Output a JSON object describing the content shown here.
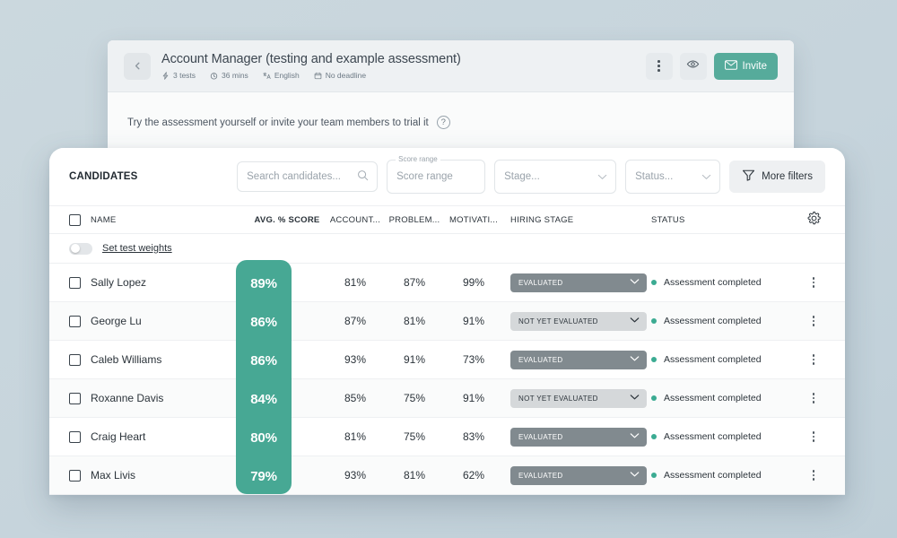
{
  "assessment": {
    "back_icon": "chevron-left-icon",
    "title": "Account Manager (testing and example assessment)",
    "meta": [
      {
        "icon": "lightning-icon",
        "label": "3 tests"
      },
      {
        "icon": "clock-icon",
        "label": "36 mins"
      },
      {
        "icon": "language-icon",
        "label": "English"
      },
      {
        "icon": "calendar-icon",
        "label": "No deadline"
      }
    ],
    "actions": {
      "kebab_icon": "more-vertical-icon",
      "preview_icon": "eye-icon",
      "invite_label": "Invite",
      "invite_icon": "envelope-icon",
      "invite_color": "#56ab9b"
    },
    "trial_banner": {
      "text": "Try the assessment yourself or invite your team members to trial it",
      "help_icon": "question-mark-icon",
      "help_glyph": "?"
    }
  },
  "candidates": {
    "panel_label": "CANDIDATES",
    "search": {
      "placeholder": "Search candidates...",
      "value": "",
      "icon": "search-icon"
    },
    "filters": [
      {
        "name": "score-range",
        "legend": "Score range",
        "value": "Score range",
        "has_caret": false
      },
      {
        "name": "stage",
        "legend": "",
        "value": "Stage...",
        "has_caret": true
      },
      {
        "name": "status",
        "legend": "",
        "value": "Status...",
        "has_caret": true
      }
    ],
    "more_filters": {
      "label": "More filters",
      "icon": "filter-icon"
    },
    "settings_icon": "gear-icon",
    "columns": [
      "NAME",
      "AVG. % SCORE",
      "ACCOUNT...",
      "PROBLEM...",
      "MOTIVATI...",
      "HIRING STAGE",
      "STATUS"
    ],
    "weights_row": {
      "label": "Set test weights",
      "toggle_on": false
    },
    "highlight_color": "#47a894",
    "status_dot_color": "#3bab92",
    "rows": [
      {
        "name": "Sally Lopez",
        "avg": "89%",
        "t1": "81%",
        "t2": "87%",
        "t3": "99%",
        "stage": "EVALUATED",
        "stage_state": "evaluated",
        "status": "Assessment completed"
      },
      {
        "name": "George Lu",
        "avg": "86%",
        "t1": "87%",
        "t2": "81%",
        "t3": "91%",
        "stage": "NOT YET EVALUATED",
        "stage_state": "not-evaluated",
        "status": "Assessment completed"
      },
      {
        "name": "Caleb Williams",
        "avg": "86%",
        "t1": "93%",
        "t2": "91%",
        "t3": "73%",
        "stage": "EVALUATED",
        "stage_state": "evaluated",
        "status": "Assessment completed"
      },
      {
        "name": "Roxanne Davis",
        "avg": "84%",
        "t1": "85%",
        "t2": "75%",
        "t3": "91%",
        "stage": "NOT YET EVALUATED",
        "stage_state": "not-evaluated",
        "status": "Assessment completed"
      },
      {
        "name": "Craig Heart",
        "avg": "80%",
        "t1": "81%",
        "t2": "75%",
        "t3": "83%",
        "stage": "EVALUATED",
        "stage_state": "evaluated",
        "status": "Assessment completed"
      },
      {
        "name": "Max Livis",
        "avg": "79%",
        "t1": "93%",
        "t2": "81%",
        "t3": "62%",
        "stage": "EVALUATED",
        "stage_state": "evaluated",
        "status": "Assessment completed"
      }
    ]
  }
}
